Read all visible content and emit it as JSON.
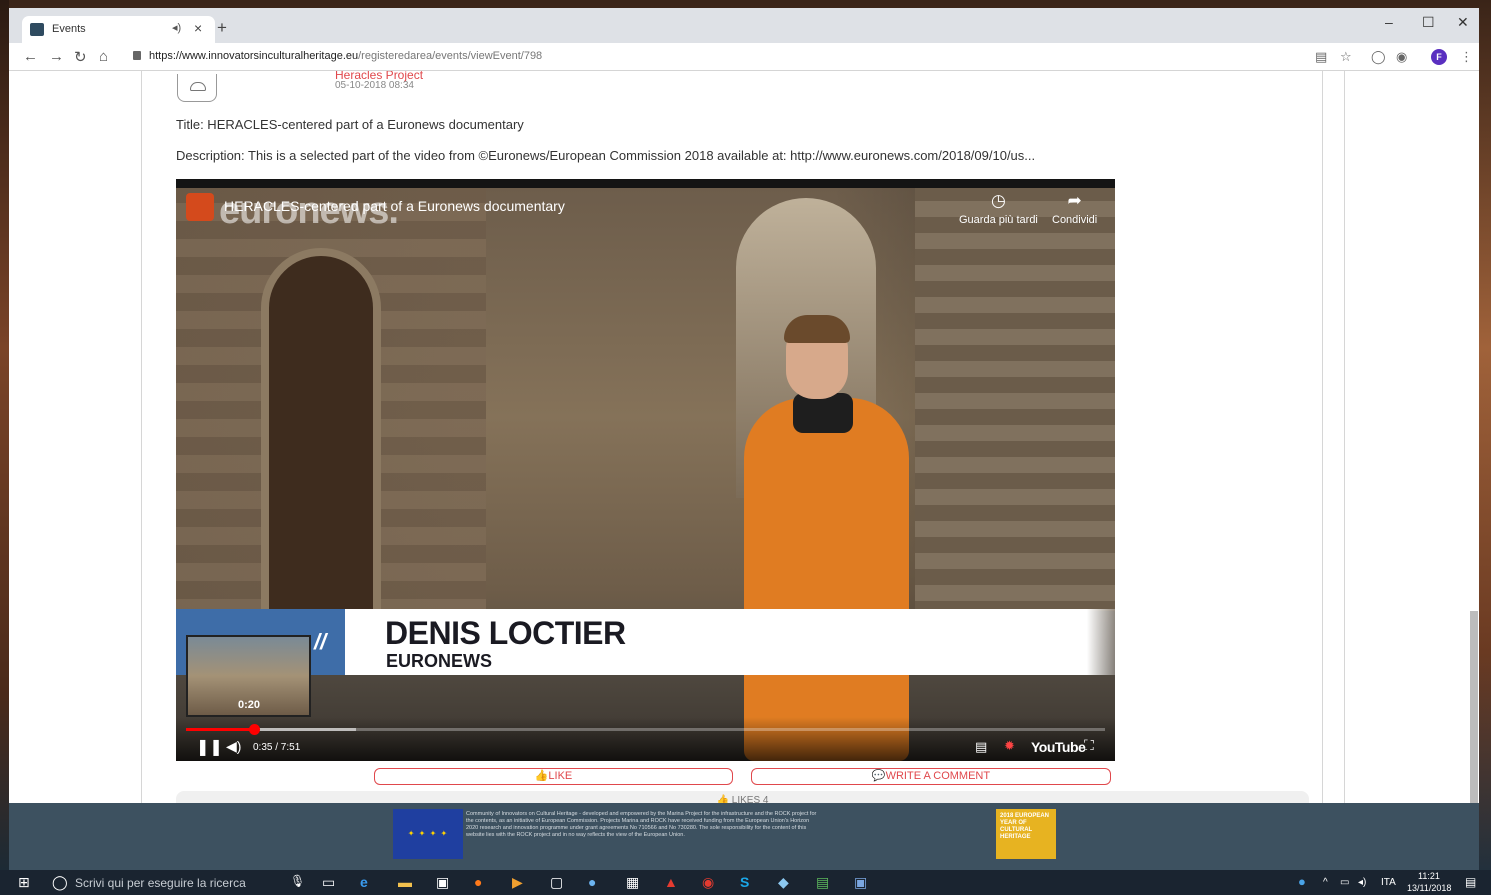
{
  "browser": {
    "tab_title": "Events",
    "url_host": "https://www.innovatorsinculturalheritage.eu",
    "url_path": "/registeredarea/events/viewEvent/798"
  },
  "post": {
    "author": "Heracles Project",
    "date": "05-10-2018 08:34",
    "title": "Title: HERACLES-centered part of a Euronews documentary",
    "description": "Description: This is a selected part of the video from ©Euronews/European Commission 2018 available at: http://www.euronews.com/2018/09/10/us..."
  },
  "video": {
    "title": "HERACLES-centered part of a Euronews documentary",
    "watermark": "euronews.",
    "watch_later": "Guarda più tardi",
    "share": "Condividi",
    "lower_third_name": "DENIS LOCTIER",
    "lower_third_org": "EURONEWS",
    "preview_time": "0:20",
    "time": "0:35 / 7:51",
    "youtube_label": "YouTube",
    "progress_fraction": 0.074
  },
  "actions": {
    "like": "LIKE",
    "comment": "WRITE A COMMENT",
    "likes_count": "LIKES 4"
  },
  "footer": {
    "text": "Community of Innovators on Cultural Heritage - developed and empowered by the Marina Project for the infrastructure and the ROCK project for the contents, as an initiative of European Commission. Projects Marina and ROCK have received funding from the European Union's Horizon 2020 research and innovation programme under grant agreements No 710566 and No 730280. The sole responsibility for the content of this website lies with the ROCK project and in no way reflects the view of the European Union.",
    "badge": "2018 EUROPEAN YEAR OF CULTURAL HERITAGE"
  },
  "taskbar": {
    "search_placeholder": "Scrivi qui per eseguire la ricerca",
    "lang": "ITA",
    "time": "11:21",
    "date": "13/11/2018"
  },
  "colors": {
    "accent": "#e0484c",
    "footer_bg": "#3d5160"
  }
}
